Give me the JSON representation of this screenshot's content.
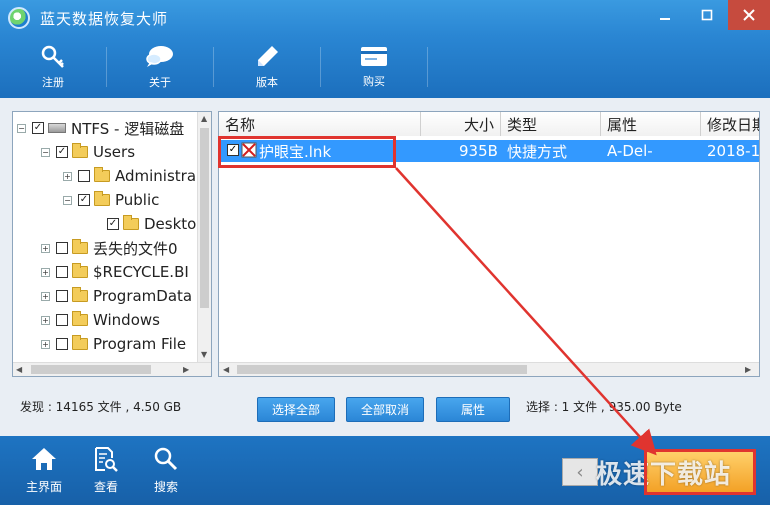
{
  "window": {
    "title": "蓝天数据恢复大师",
    "controls": [
      "minimize",
      "maximize",
      "close"
    ]
  },
  "toolbar": {
    "items": [
      {
        "label": "注册",
        "icon": "key-icon"
      },
      {
        "label": "关于",
        "icon": "chat-bubble-icon"
      },
      {
        "label": "版本",
        "icon": "pen-icon"
      },
      {
        "label": "购买",
        "icon": "card-icon"
      }
    ]
  },
  "tree": {
    "items": [
      {
        "label": "NTFS - 逻辑磁盘",
        "checked": true
      },
      {
        "label": "Users",
        "checked": true
      },
      {
        "label": "Administra",
        "checked": false
      },
      {
        "label": "Public",
        "checked": true
      },
      {
        "label": "Deskto",
        "checked": true
      },
      {
        "label": "丢失的文件0",
        "checked": false
      },
      {
        "label": "$RECYCLE.BI",
        "checked": false
      },
      {
        "label": "ProgramData",
        "checked": false
      },
      {
        "label": "Windows",
        "checked": false
      },
      {
        "label": "Program File",
        "checked": false
      }
    ]
  },
  "file_list": {
    "columns": [
      "名称",
      "大小",
      "类型",
      "属性",
      "修改日期"
    ],
    "rows": [
      {
        "name": "护眼宝.lnk",
        "size": "935B",
        "type": "快捷方式",
        "attr": "A-Del-",
        "date": "2018-1",
        "checked": true,
        "selected": true
      }
    ]
  },
  "status": {
    "found": "发现 : 14165 文件 , 4.50 GB",
    "selection": "选择 : 1 文件 , 935.00 Byte"
  },
  "actions": {
    "select_all": "选择全部",
    "deselect_all": "全部取消",
    "properties": "属性"
  },
  "bottom_nav": {
    "items": [
      {
        "label": "主界面",
        "icon": "home-icon"
      },
      {
        "label": "查看",
        "icon": "document-search-icon"
      },
      {
        "label": "搜索",
        "icon": "magnifier-icon"
      }
    ],
    "back_glyph": "‹",
    "watermark": "极速下载站"
  },
  "colors": {
    "accent": "#1e6fb8",
    "selection": "#3399ff",
    "highlight_box": "#e0342f",
    "next_button": "#f3a126"
  }
}
